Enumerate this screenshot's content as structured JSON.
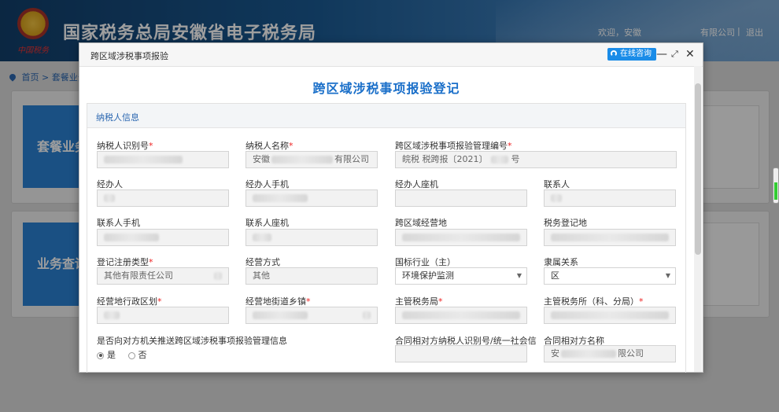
{
  "header": {
    "title": "国家税务总局安徽省电子税务局",
    "emblem_caption": "中国税务",
    "welcome": "欢迎，安徽",
    "company": "有限公司",
    "separator": "|",
    "logout": "退出"
  },
  "breadcrumb": {
    "home": "首页",
    "sep": ">",
    "current": "套餐业务"
  },
  "background_tiles": [
    {
      "label": "套餐业务"
    },
    {
      "label": "业务查询"
    }
  ],
  "modal": {
    "window_title": "跨区域涉税事项报验",
    "consult_label": "在线咨询",
    "min_label": "—",
    "max_label": "⤢",
    "close_label": "✕",
    "form_title": "跨区域涉税事项报验登记",
    "section_title": "纳税人信息",
    "fields": {
      "taxpayer_id": {
        "label": "纳税人识别号",
        "value": ""
      },
      "taxpayer_name": {
        "label": "纳税人名称",
        "value_prefix": "安徽",
        "value_suffix": "有限公司"
      },
      "report_no": {
        "label": "跨区域涉税事项报验管理编号",
        "value": "皖税 税跨报〔2021〕",
        "value_suffix": "号"
      },
      "handler": {
        "label": "经办人",
        "value": ""
      },
      "handler_mobile": {
        "label": "经办人手机",
        "value": ""
      },
      "handler_landline": {
        "label": "经办人座机",
        "value": ""
      },
      "contact": {
        "label": "联系人",
        "value": ""
      },
      "contact_mobile": {
        "label": "联系人手机",
        "value": ""
      },
      "contact_landline": {
        "label": "联系人座机",
        "value": ""
      },
      "cross_region_place": {
        "label": "跨区域经营地",
        "value": ""
      },
      "registration_place": {
        "label": "税务登记地",
        "value": ""
      },
      "reg_type": {
        "label": "登记注册类型",
        "value": "其他有限责任公司"
      },
      "operation_mode": {
        "label": "经营方式",
        "value": "其他"
      },
      "industry": {
        "label": "国标行业（主）",
        "value": "环境保护监测"
      },
      "affiliation": {
        "label": "隶属关系",
        "value": "区"
      },
      "district": {
        "label": "经营地行政区划",
        "value": ""
      },
      "street": {
        "label": "经营地街道乡镇",
        "value": ""
      },
      "tax_bureau": {
        "label": "主管税务局",
        "value": ""
      },
      "tax_office": {
        "label": "主管税务所（科、分局）",
        "value": ""
      },
      "push_info": {
        "label": "是否向对方机关推送跨区域涉税事项报验管理信息",
        "yes": "是",
        "no": "否"
      },
      "counterparty_id": {
        "label": "合同相对方纳税人识别号/统一社会信",
        "value": ""
      },
      "counterparty_name": {
        "label": "合同相对方名称",
        "value_prefix": "安",
        "value_suffix": "限公司"
      }
    },
    "required_mark": "*"
  }
}
